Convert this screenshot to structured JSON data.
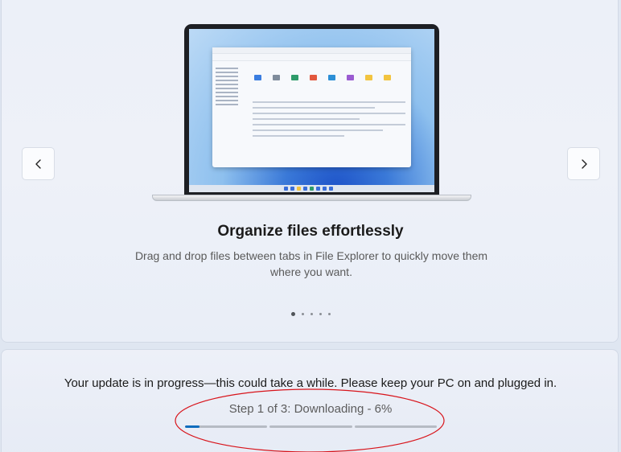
{
  "carousel": {
    "prev_label": "Previous",
    "next_label": "Next",
    "slide": {
      "title": "Organize files effortlessly",
      "description": "Drag and drop files between tabs in File Explorer to quickly move them where you want."
    },
    "total_slides": 5,
    "active_slide": 1
  },
  "update": {
    "message": "Your update is in progress—this could take a while. Please keep your PC on and plugged in.",
    "step_text": "Step 1 of 3: Downloading - 6%",
    "step_current": 1,
    "step_total": 3,
    "percent": 6
  },
  "colors": {
    "progress_fill": "#0f6cbd",
    "progress_track": "#b6bbc4",
    "annotation": "#d8141b"
  },
  "icons": {
    "prev": "chevron-left-icon",
    "next": "chevron-right-icon"
  }
}
